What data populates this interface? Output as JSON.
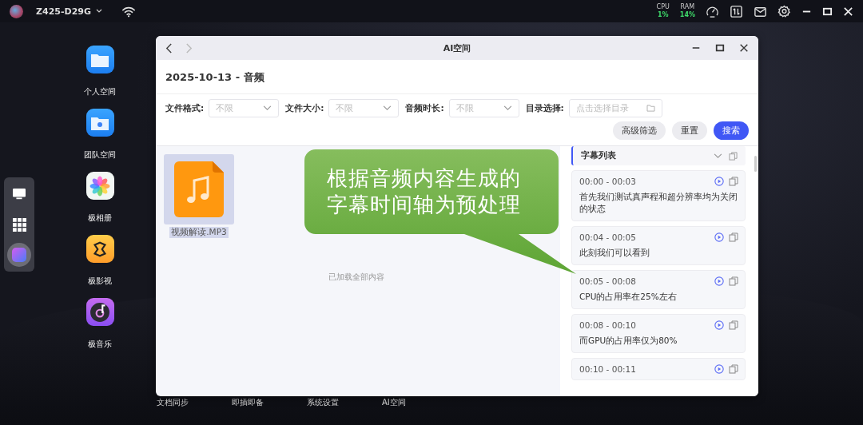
{
  "topbar": {
    "device": "Z425-D29G",
    "cpu_label": "CPU",
    "cpu": "1%",
    "ram_label": "RAM",
    "ram": "14%"
  },
  "dock": [
    {
      "kind": "monitor",
      "selected": false
    },
    {
      "kind": "grid",
      "selected": false
    },
    {
      "kind": "ai",
      "selected": true
    }
  ],
  "desktop_apps": [
    {
      "kind": "folder",
      "label": "个人空间"
    },
    {
      "kind": "team",
      "label": "团队空间"
    },
    {
      "kind": "photos",
      "label": "极相册"
    },
    {
      "kind": "video",
      "label": "极影视"
    },
    {
      "kind": "music",
      "label": "极音乐"
    }
  ],
  "bottom_labels": [
    "文档同步",
    "即插即备",
    "系统设置",
    "AI空间"
  ],
  "window": {
    "title": "AI空间",
    "heading": "2025-10-13 - 音频",
    "filters": [
      {
        "kind": "select",
        "label": "文件格式:",
        "placeholder": "不限"
      },
      {
        "kind": "select",
        "label": "文件大小:",
        "placeholder": "不限"
      },
      {
        "kind": "select",
        "label": "音频时长:",
        "placeholder": "不限"
      },
      {
        "kind": "folder",
        "label": "目录选择:",
        "placeholder": "点击选择目录"
      }
    ],
    "buttons": [
      {
        "label": "高级筛选",
        "primary": false
      },
      {
        "label": "重置",
        "primary": false
      },
      {
        "label": "搜索",
        "primary": true
      }
    ],
    "files": [
      {
        "name": "视频解读.MP3",
        "selected": true
      }
    ],
    "status": "已加载全部内容",
    "subtitle_panel": {
      "title": "字幕列表",
      "items": [
        {
          "time": "00:00 - 00:03",
          "text": "首先我们测试真声程和超分辨率均为关闭的状态"
        },
        {
          "time": "00:04 - 00:05",
          "text": "此刻我们可以看到"
        },
        {
          "time": "00:05 - 00:08",
          "text": "CPU的占用率在25%左右"
        },
        {
          "time": "00:08 - 00:10",
          "text": "而GPU的占用率仅为80%"
        },
        {
          "time": "00:10 - 00:11"
        }
      ]
    }
  },
  "callout": {
    "lines": [
      "根据音频内容生成的",
      "字幕时间轴为预处理"
    ]
  }
}
